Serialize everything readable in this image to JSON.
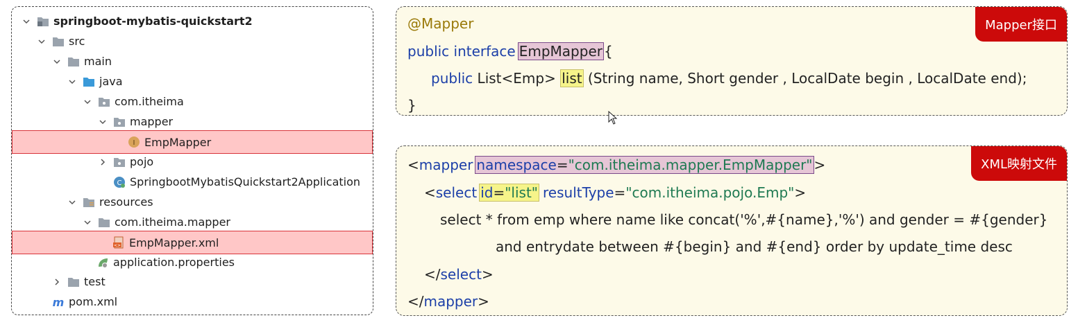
{
  "tree": {
    "root": "springboot-mybatis-quickstart2",
    "src": "src",
    "main": "main",
    "java": "java",
    "pkg": "com.itheima",
    "mapper": "mapper",
    "empmapper": "EmpMapper",
    "pojo": "pojo",
    "app": "SpringbootMybatisQuickstart2Application",
    "resources": "resources",
    "res_pkg": "com.itheima.mapper",
    "xml": "EmpMapper.xml",
    "props": "application.properties",
    "test": "test",
    "pom": "pom.xml"
  },
  "mapper_panel": {
    "tag": "Mapper接口",
    "annotation": "@Mapper",
    "kw_public_interface": "public interface",
    "iface_name": "EmpMapper",
    "brace_open": " {",
    "kw_public": "public",
    "return_type": " List<Emp> ",
    "method_name": "list",
    "params": " (String name, Short gender , LocalDate begin , LocalDate end);",
    "brace_close": "}"
  },
  "xml_panel": {
    "tag": "XML映射文件",
    "lt1": "<",
    "mapper_tag": "mapper",
    "ns_attr": "namespace",
    "eq1": "=",
    "ns_val": "\"com.itheima.mapper.EmpMapper\"",
    "gt1": ">",
    "lt2": "<",
    "select_tag": "select",
    "id_attr": "id",
    "eq2": "=",
    "id_val": "\"list\"",
    "rt_attr": "resultType",
    "eq3": "=",
    "rt_val": "\"com.itheima.pojo.Emp\"",
    "gt2": ">",
    "sql1": "select * from emp where name like concat('%',#{name},'%') and gender = #{gender}",
    "sql2": "and entrydate between #{begin} and #{end} order by update_time desc",
    "close_select_lt": "</",
    "close_select": "select",
    "close_select_gt": ">",
    "close_mapper_lt": "</",
    "close_mapper": "mapper",
    "close_mapper_gt": ">"
  }
}
